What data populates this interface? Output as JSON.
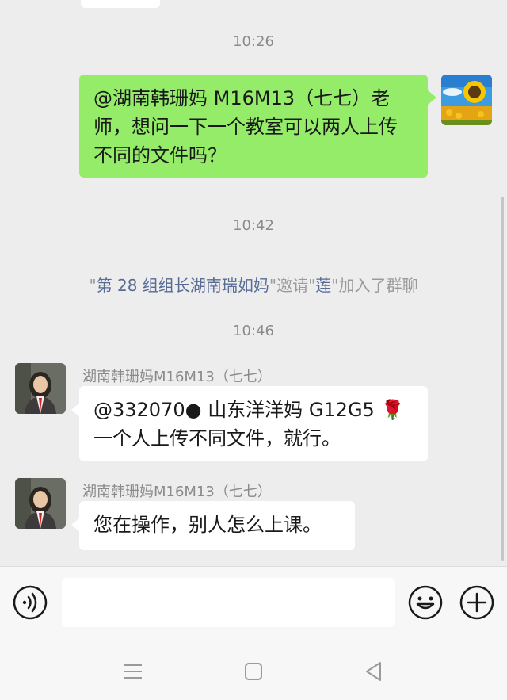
{
  "colors": {
    "background": "#ededed",
    "self_bubble": "#95ec69",
    "other_bubble": "#ffffff",
    "timestamp": "#8a8a8a",
    "system_name": "#576b95"
  },
  "chat": {
    "messages": [
      {
        "type": "time",
        "text": "10:26"
      },
      {
        "type": "self",
        "text": "@湖南韩珊妈 M16M13（七七）老师，想问一下一个教室可以两人上传不同的文件吗？",
        "avatar": "sunflower-avatar"
      },
      {
        "type": "time",
        "text": "10:42"
      },
      {
        "type": "system",
        "parts": [
          "\"",
          "第 28 组组长湖南瑞如妈",
          "\"邀请\"",
          "莲",
          "\"加入了群聊"
        ]
      },
      {
        "type": "time",
        "text": "10:46"
      },
      {
        "type": "other",
        "sender": "湖南韩珊妈M16M13（七七）",
        "text": "@332070● 山东洋洋妈 G12G5 🌹一个人上传不同文件，就行。",
        "avatar": "girl-avatar"
      },
      {
        "type": "other",
        "sender": "湖南韩珊妈M16M13（七七）",
        "text": "您在操作，别人怎么上课。",
        "avatar": "girl-avatar"
      }
    ]
  },
  "input_bar": {
    "voice_icon": "voice-icon",
    "input_value": "",
    "emoji_icon": "emoji-icon",
    "plus_icon": "plus-icon"
  },
  "nav_bar": {
    "icons": [
      "menu-icon",
      "home-square-icon",
      "back-triangle-icon"
    ]
  }
}
